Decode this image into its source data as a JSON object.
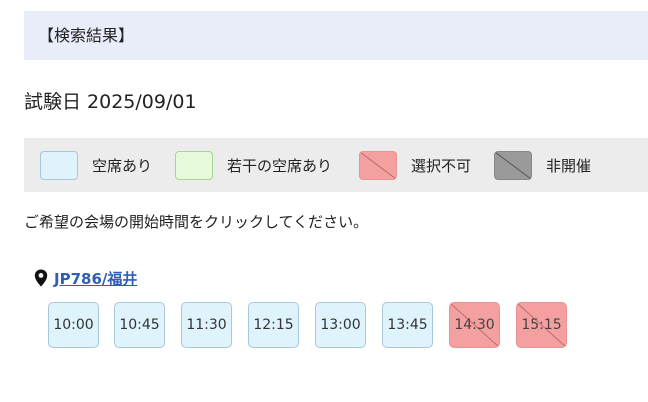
{
  "header": {
    "title": "【検索結果】"
  },
  "exam": {
    "date_label": "試験日 2025/09/01"
  },
  "legend": {
    "items": [
      {
        "label": "空席あり",
        "color": "#dff3fc",
        "border": "#a8c7db"
      },
      {
        "label": "若干の空席あり",
        "color": "#e6f9db",
        "border": "#a6d68f"
      },
      {
        "label": "選択不可",
        "color": "#f4a0a0",
        "border": "#e59595"
      },
      {
        "label": "非開催",
        "color": "#9a9a9a",
        "border": "#888888"
      }
    ]
  },
  "instruction": "ご希望の会場の開始時間をクリックしてください。",
  "venue": {
    "icon": "map-pin-icon",
    "name": "JP786/福井",
    "slots": [
      {
        "time": "10:00",
        "status": "空席あり"
      },
      {
        "time": "10:45",
        "status": "空席あり"
      },
      {
        "time": "11:30",
        "status": "空席あり"
      },
      {
        "time": "12:15",
        "status": "空席あり"
      },
      {
        "time": "13:00",
        "status": "空席あり"
      },
      {
        "time": "13:45",
        "status": "空席あり"
      },
      {
        "time": "14:30",
        "status": "選択不可"
      },
      {
        "time": "15:15",
        "status": "選択不可"
      }
    ]
  }
}
